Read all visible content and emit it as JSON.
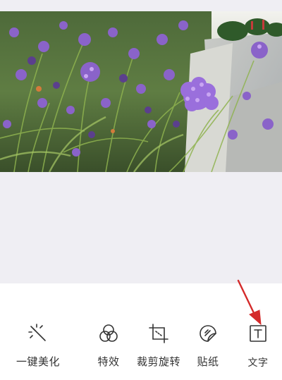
{
  "photo": {
    "subject": "purple-verbena-flowers"
  },
  "toolbar": {
    "tools": [
      {
        "label": "一键美化",
        "icon": "magic-wand-icon"
      },
      {
        "label": "特效",
        "icon": "effects-circles-icon"
      },
      {
        "label": "裁剪旋转",
        "icon": "crop-rotate-icon"
      },
      {
        "label": "贴纸",
        "icon": "sticker-icon"
      },
      {
        "label": "文字",
        "icon": "text-icon"
      }
    ]
  },
  "annotation": {
    "arrow_color": "#d42a2a"
  }
}
